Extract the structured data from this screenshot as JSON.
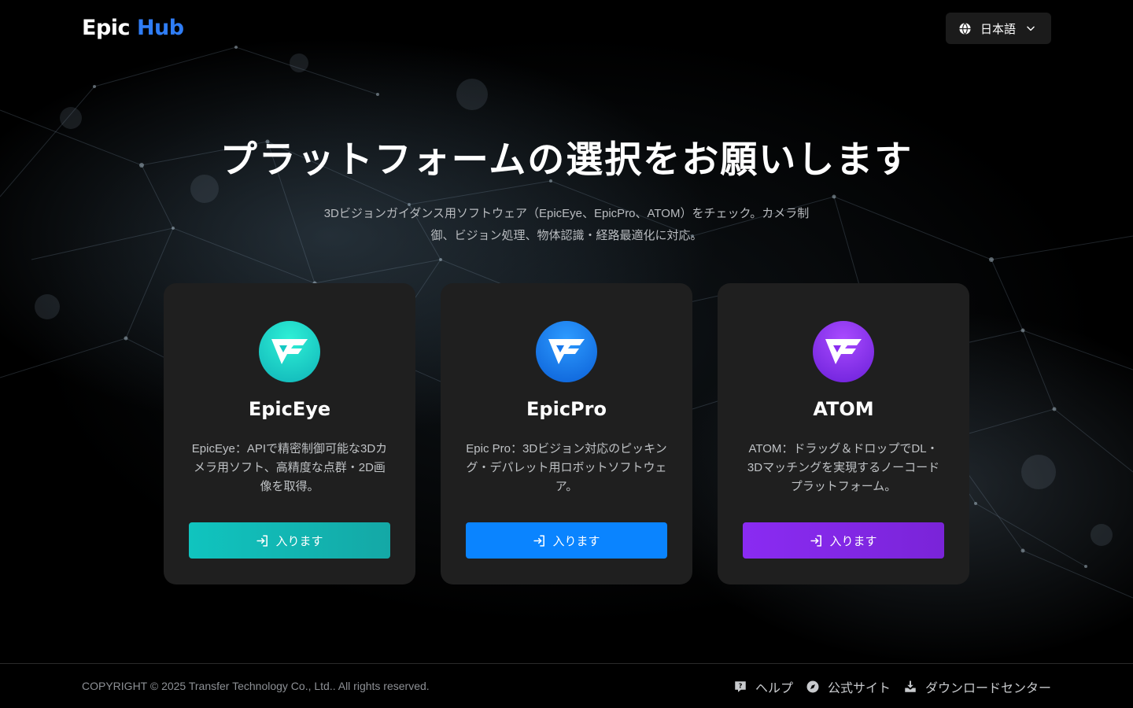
{
  "brand": {
    "name_part1": "Epic",
    "name_part2": "Hub",
    "accent_color": "#2f7df6"
  },
  "language_selector": {
    "label": "日本語",
    "icon": "globe-icon"
  },
  "hero": {
    "title": "プラットフォームの選択をお願いします",
    "subtitle": "3Dビジョンガイダンス用ソフトウェア（EpicEye、EpicPro、ATOM）をチェック。カメラ制御、ビジョン処理、物体認識・経路最適化に対応。"
  },
  "platforms": [
    {
      "name": "EpicEye",
      "description": "EpicEye：APIで精密制御可能な3Dカメラ用ソフト、高精度な点群・2D画像を取得。",
      "button_label": "入ります",
      "icon": "epiceye-logo-icon",
      "color": "#14c9c3"
    },
    {
      "name": "EpicPro",
      "description": "Epic Pro：3Dビジョン対応のピッキング・デパレット用ロボットソフトウェア。",
      "button_label": "入ります",
      "icon": "epicpro-logo-icon",
      "color": "#0a84ff"
    },
    {
      "name": "ATOM",
      "description": "ATOM：ドラッグ＆ドロップでDL・3Dマッチングを実現するノーコードプラットフォーム。",
      "button_label": "入ります",
      "icon": "atom-logo-icon",
      "color": "#8b2cf0"
    }
  ],
  "footer": {
    "copyright": "COPYRIGHT © 2025 Transfer Technology Co., Ltd.. All rights reserved.",
    "links": [
      {
        "label": "ヘルプ",
        "icon": "help-chat-icon"
      },
      {
        "label": "公式サイト",
        "icon": "compass-icon"
      },
      {
        "label": "ダウンロードセンター",
        "icon": "download-icon"
      }
    ]
  }
}
